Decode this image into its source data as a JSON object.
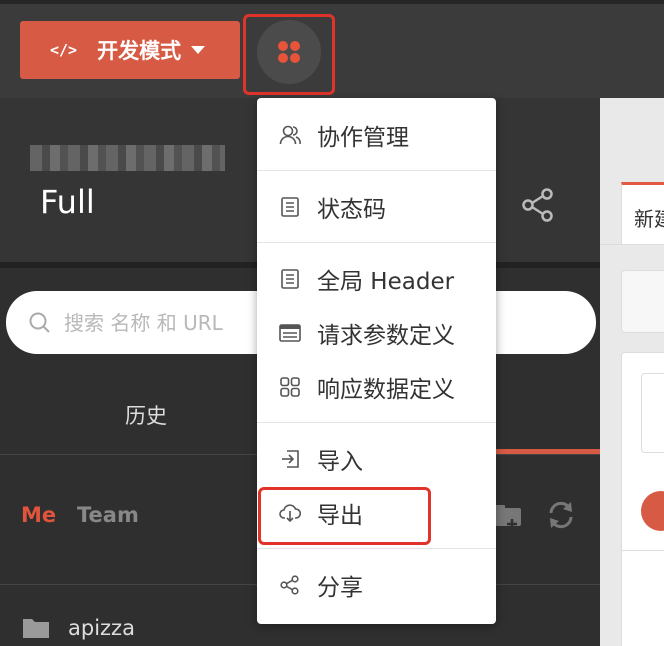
{
  "topbar": {
    "dev_mode_button": {
      "icon": "code-icon",
      "label": "开发模式"
    },
    "menu_button_icon": "clover-icon"
  },
  "project": {
    "name": "Full"
  },
  "search": {
    "placeholder": "搜索 名称 和 URL"
  },
  "tabs": {
    "history": "历史"
  },
  "team_tabs": {
    "me": "Me",
    "team": "Team"
  },
  "folders": [
    {
      "name": "apizza",
      "icon": "folder-icon"
    }
  ],
  "dropdown": {
    "items": [
      {
        "label": "协作管理",
        "icon": "users-icon"
      },
      {
        "label": "状态码",
        "icon": "list-icon"
      },
      {
        "label": "全局 Header",
        "icon": "list-icon"
      },
      {
        "label": "请求参数定义",
        "icon": "table-icon"
      },
      {
        "label": "响应数据定义",
        "icon": "grid-icon"
      },
      {
        "label": "导入",
        "icon": "import-icon"
      },
      {
        "label": "导出",
        "icon": "cloud-download-icon"
      },
      {
        "label": "分享",
        "icon": "share-icon"
      }
    ]
  },
  "right_panel": {
    "tab_label": "新建"
  },
  "colors": {
    "accent": "#d65a44",
    "highlight_outline": "#e0342a",
    "topbar": "#3b3b3b",
    "panel": "#2f2f2f"
  }
}
